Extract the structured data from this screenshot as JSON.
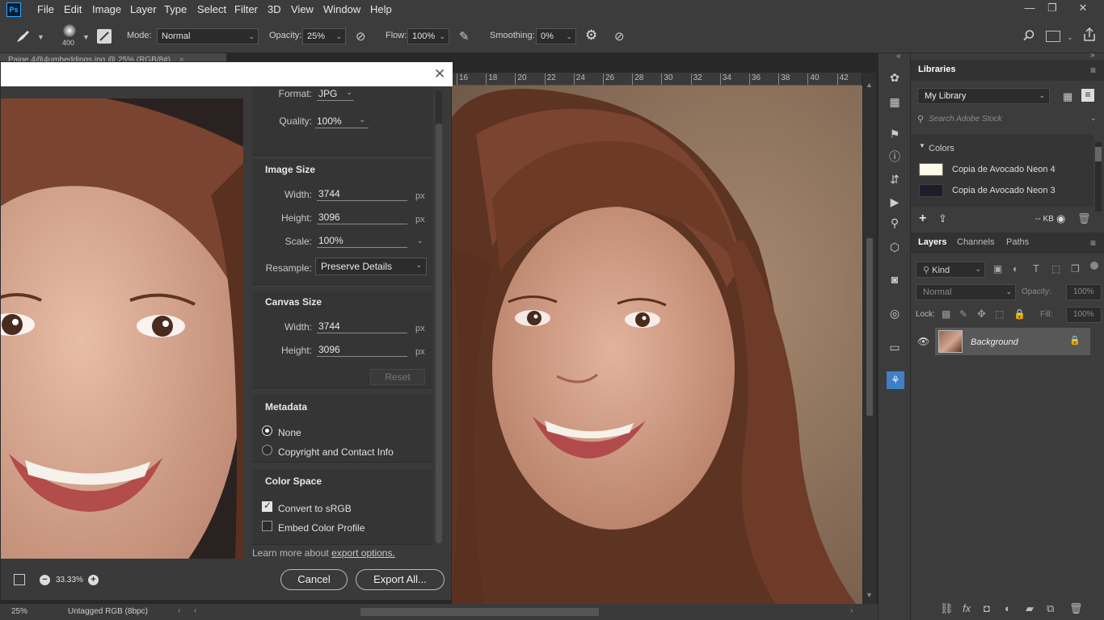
{
  "app": {
    "logo": "Ps"
  },
  "menu": [
    "File",
    "Edit",
    "Image",
    "Layer",
    "Type",
    "Select",
    "Filter",
    "3D",
    "View",
    "Window",
    "Help"
  ],
  "options": {
    "brush_size": "400",
    "mode_label": "Mode:",
    "mode_value": "Normal",
    "opacity_label": "Opacity:",
    "opacity_value": "25%",
    "flow_label": "Flow:",
    "flow_value": "100%",
    "smoothing_label": "Smoothing:",
    "smoothing_value": "0%"
  },
  "doc_tab": "Paige 4@4umbeddings.jpg @ 25% (RGB/8#)",
  "ruler_ticks": [
    "16",
    "18",
    "20",
    "22",
    "24",
    "26",
    "28",
    "30",
    "32",
    "34",
    "36",
    "38",
    "40",
    "42"
  ],
  "status": {
    "zoom": "25%",
    "profile": "Untagged RGB (8bpc)"
  },
  "dialog": {
    "format_label": "Format:",
    "format_value": "JPG",
    "quality_label": "Quality:",
    "quality_value": "100%",
    "image_size": {
      "title": "Image Size",
      "width_label": "Width:",
      "width_value": "3744",
      "height_label": "Height:",
      "height_value": "3096",
      "unit": "px",
      "scale_label": "Scale:",
      "scale_value": "100%",
      "resample_label": "Resample:",
      "resample_value": "Preserve Details"
    },
    "canvas_size": {
      "title": "Canvas Size",
      "width_label": "Width:",
      "width_value": "3744",
      "height_label": "Height:",
      "height_value": "3096",
      "unit": "px",
      "reset_label": "Reset"
    },
    "metadata": {
      "title": "Metadata",
      "opt_none": "None",
      "opt_copyright": "Copyright and Contact Info"
    },
    "color_space": {
      "title": "Color Space",
      "opt_convert": "Convert to sRGB",
      "opt_embed": "Embed Color Profile"
    },
    "learn_more_prefix": "Learn more about",
    "learn_more_link": "export options.",
    "zoom_value": "33.33%",
    "cancel_label": "Cancel",
    "export_label": "Export All..."
  },
  "libraries": {
    "title": "Libraries",
    "library_select": "My Library",
    "search_placeholder": "Search Adobe Stock",
    "colors_title": "Colors",
    "colors": [
      {
        "name": "Copia de Avocado Neon 4",
        "swatch": "#fffbe8"
      },
      {
        "name": "Copia de Avocado Neon 3",
        "swatch": "#1d1e2a"
      }
    ],
    "size_label": "-- KB"
  },
  "layers": {
    "tabs": [
      "Layers",
      "Channels",
      "Paths"
    ],
    "kind_label": "Kind",
    "blend_mode": "Normal",
    "opacity_label": "Opacity:",
    "opacity_value": "100%",
    "lock_label": "Lock:",
    "fill_label": "Fill:",
    "fill_value": "100%",
    "layer_name": "Background"
  }
}
